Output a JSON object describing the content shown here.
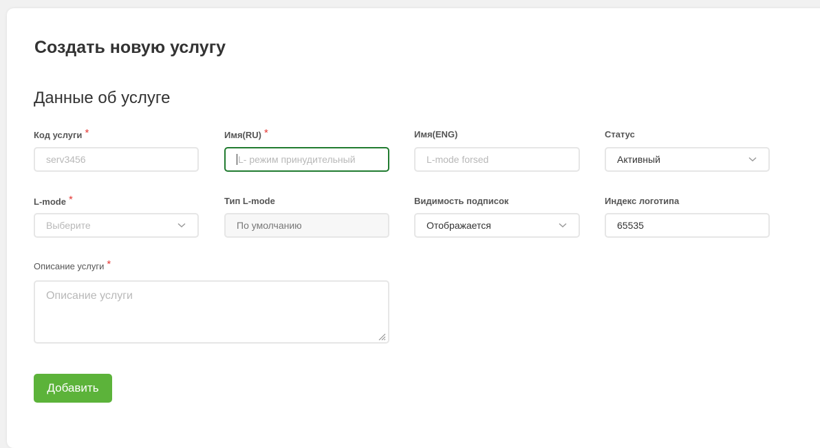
{
  "page": {
    "title": "Создать новую услугу",
    "section_title": "Данные об услуге"
  },
  "form": {
    "service_code": {
      "label": "Код услуги",
      "required_mark": "*",
      "placeholder": "serv3456"
    },
    "name_ru": {
      "label": "Имя(RU)",
      "required_mark": "*",
      "placeholder": "L- режим принудительный"
    },
    "name_eng": {
      "label": "Имя(ENG)",
      "placeholder": "L-mode forsed"
    },
    "status": {
      "label": "Статус",
      "value": "Активный",
      "icon": "chevron-down-icon"
    },
    "l_mode": {
      "label": "L-mode",
      "required_mark": "*",
      "placeholder": "Выберите",
      "icon": "chevron-down-icon"
    },
    "l_mode_type": {
      "label": "Тип L-mode",
      "value": "По умолчанию"
    },
    "subscription_visibility": {
      "label": "Видимость подписок",
      "value": "Отображается",
      "icon": "chevron-down-icon"
    },
    "logo_index": {
      "label": "Индекс логотипа",
      "value": "65535"
    },
    "description": {
      "label": "Описание услуги",
      "required_mark": "*",
      "placeholder": "Описание услуги"
    }
  },
  "actions": {
    "add_label": "Добавить"
  },
  "colors": {
    "accent_green": "#5cb33a",
    "focus_border": "#1f7a2e",
    "required": "#e53935"
  }
}
